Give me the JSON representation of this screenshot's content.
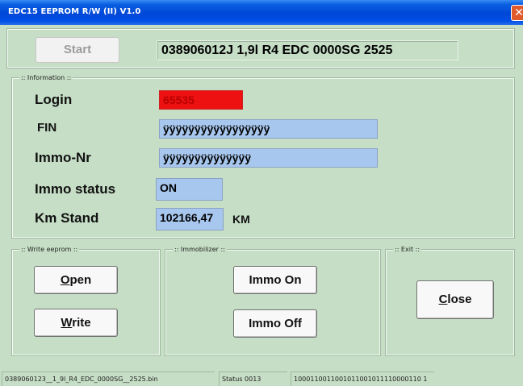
{
  "window": {
    "title": "EDC15 EEPROM R/W (II) V1.0",
    "close_glyph": "✕"
  },
  "toolbar": {
    "start_label": "Start",
    "ecu_info": "038906012J  1,9l R4 EDC 0000SG  2525"
  },
  "information": {
    "group_title": ":: Information ::",
    "login_label": "Login",
    "login_value": "65535",
    "fin_label": "FIN",
    "fin_value": "ÿÿÿÿÿÿÿÿÿÿÿÿÿÿÿÿÿ",
    "immo_nr_label": "Immo-Nr",
    "immo_nr_value": "ÿÿÿÿÿÿÿÿÿÿÿÿÿÿ",
    "immo_status_label": "Immo status",
    "immo_status_value": "ON",
    "km_label": "Km Stand",
    "km_value": "102166,47",
    "km_unit": "KM"
  },
  "write_eeprom": {
    "group_title": ":: Write eeprom ::",
    "open_label_u": "O",
    "open_label_rest": "pen",
    "write_label_u": "W",
    "write_label_rest": "rite"
  },
  "immobilizer": {
    "group_title": ":: Immobilizer ::",
    "immo_on_label": "Immo On",
    "immo_off_label": "Immo Off"
  },
  "exit": {
    "group_title": ":: Exit ::",
    "close_label_u": "C",
    "close_label_rest": "lose"
  },
  "statusbar": {
    "file": "0389060123__1_9l_R4_EDC_0000SG__2525.bin",
    "status": "Status 0013",
    "bits": "1000110011001011001011110000110 1"
  },
  "colors": {
    "accent": "#0047d8",
    "background": "#c6dec6",
    "field_blue": "#a7c7ee",
    "login_red": "#ee1111"
  }
}
